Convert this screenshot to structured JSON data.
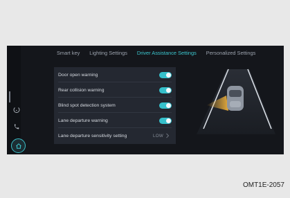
{
  "tabs": [
    {
      "label": "Smart key"
    },
    {
      "label": "Lighting Settings"
    },
    {
      "label": "Driver Assistance Settings"
    },
    {
      "label": "Personalized Settings"
    }
  ],
  "active_tab": "Driver Assistance Settings",
  "settings": [
    {
      "label": "Door open warning",
      "enabled": true
    },
    {
      "label": "Rear collision warning",
      "enabled": true
    },
    {
      "label": "Blind spot detection system",
      "enabled": true
    },
    {
      "label": "Lane departure warning",
      "enabled": true
    },
    {
      "label": "Lane departure sensitivity setting",
      "value": "LOW"
    }
  ],
  "rail": {
    "icons": [
      "voice-icon",
      "phone-icon",
      "home-icon"
    ]
  },
  "accent_color": "#3cc7cf",
  "caption": "OMT1E-2057"
}
